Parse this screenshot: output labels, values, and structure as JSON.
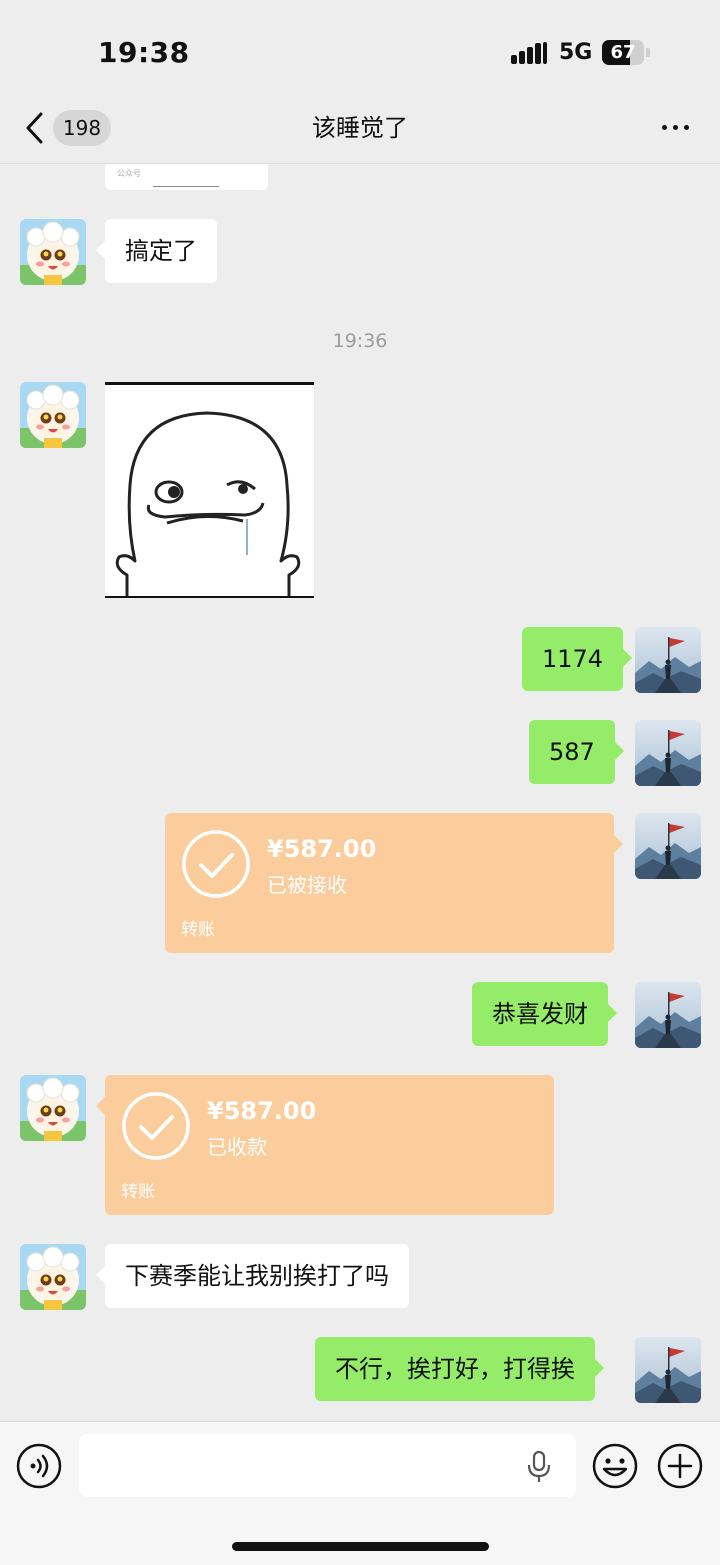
{
  "status_bar": {
    "time": "19:38",
    "network": "5G",
    "battery": "67",
    "battery_level": 0.67
  },
  "nav": {
    "unread_count": "198",
    "title": "该睡觉了"
  },
  "chat": {
    "clip_card_tag": "公众号",
    "timestamp": "19:36",
    "messages": {
      "m1": "搞定了",
      "m2": "1174",
      "m3": "587",
      "m4": "恭喜发财",
      "m5": "下赛季能让我别挨打了吗",
      "m6": "不行，挨打好，打得挨"
    },
    "transfers": {
      "sent": {
        "amount": "¥587.00",
        "status": "已被接收",
        "kind": "转账"
      },
      "received": {
        "amount": "¥587.00",
        "status": "已收款",
        "kind": "转账"
      }
    }
  },
  "input": {
    "placeholder": ""
  },
  "colors": {
    "sent_bubble": "#95ec69",
    "received_bubble": "#ffffff",
    "transfer": "#fbcd9d",
    "background": "#ededed"
  },
  "icons": [
    "back-chevron-icon",
    "more-dots-icon",
    "voice-icon",
    "microphone-icon",
    "emoji-icon",
    "plus-icon",
    "check-circle-icon"
  ]
}
